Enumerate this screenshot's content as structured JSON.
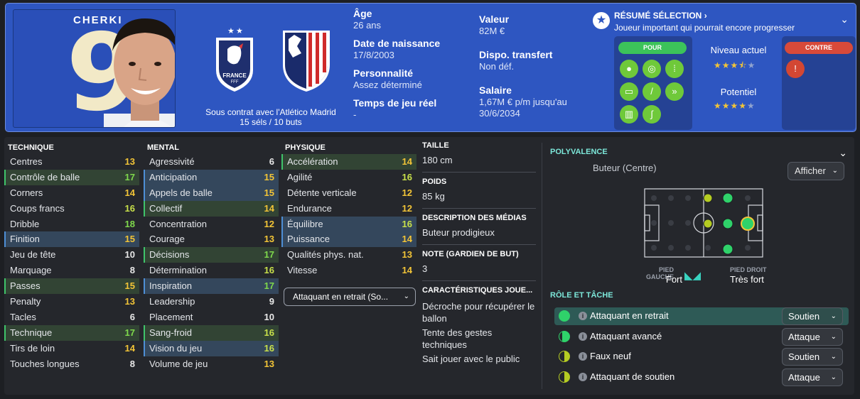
{
  "player": {
    "shirt_name": "CHERKI",
    "shirt_number": "9",
    "contract_line1": "Sous contrat avec l'Atlético Madrid",
    "contract_line2": "15 séls / 10 buts"
  },
  "crests": {
    "nation": "FRANCE",
    "nation_sub": "FFF"
  },
  "info_left": [
    {
      "label": "Âge",
      "value": "26 ans"
    },
    {
      "label": "Date de naissance",
      "value": "17/8/2003"
    },
    {
      "label": "Personnalité",
      "value": "Assez déterminé"
    },
    {
      "label": "Temps de jeu réel",
      "value": "-"
    }
  ],
  "info_right": [
    {
      "label": "Valeur",
      "value": "82M €"
    },
    {
      "label": "Dispo. transfert",
      "value": "Non déf."
    },
    {
      "label": "Salaire",
      "value": "1,67M € p/m jusqu'au 30/6/2034"
    }
  ],
  "selection": {
    "title": "RÉSUMÉ SÉLECTION",
    "subtitle": "Joueur important qui pourrait encore progresser",
    "pour": "POUR",
    "contre": "CONTRE",
    "niveau_label": "Niveau actuel",
    "niveau_stars": 3.5,
    "potentiel_label": "Potentiel",
    "potentiel_stars": 4
  },
  "technique": {
    "title": "TECHNIQUE",
    "rows": [
      {
        "name": "Centres",
        "value": "13"
      },
      {
        "name": "Contrôle de balle",
        "value": "17"
      },
      {
        "name": "Corners",
        "value": "14"
      },
      {
        "name": "Coups francs",
        "value": "16"
      },
      {
        "name": "Dribble",
        "value": "18"
      },
      {
        "name": "Finition",
        "value": "15"
      },
      {
        "name": "Jeu de tête",
        "value": "10"
      },
      {
        "name": "Marquage",
        "value": "8"
      },
      {
        "name": "Passes",
        "value": "15"
      },
      {
        "name": "Penalty",
        "value": "13"
      },
      {
        "name": "Tacles",
        "value": "6"
      },
      {
        "name": "Technique",
        "value": "17"
      },
      {
        "name": "Tirs de loin",
        "value": "14"
      },
      {
        "name": "Touches longues",
        "value": "8"
      }
    ]
  },
  "mental": {
    "title": "MENTAL",
    "rows": [
      {
        "name": "Agressivité",
        "value": "6"
      },
      {
        "name": "Anticipation",
        "value": "15"
      },
      {
        "name": "Appels de balle",
        "value": "15"
      },
      {
        "name": "Collectif",
        "value": "14"
      },
      {
        "name": "Concentration",
        "value": "12"
      },
      {
        "name": "Courage",
        "value": "13"
      },
      {
        "name": "Décisions",
        "value": "17"
      },
      {
        "name": "Détermination",
        "value": "16"
      },
      {
        "name": "Inspiration",
        "value": "17"
      },
      {
        "name": "Leadership",
        "value": "9"
      },
      {
        "name": "Placement",
        "value": "10"
      },
      {
        "name": "Sang-froid",
        "value": "16"
      },
      {
        "name": "Vision du jeu",
        "value": "16"
      },
      {
        "name": "Volume de jeu",
        "value": "13"
      }
    ]
  },
  "physique": {
    "title": "PHYSIQUE",
    "rows": [
      {
        "name": "Accélération",
        "value": "14"
      },
      {
        "name": "Agilité",
        "value": "16"
      },
      {
        "name": "Détente verticale",
        "value": "12"
      },
      {
        "name": "Endurance",
        "value": "12"
      },
      {
        "name": "Équilibre",
        "value": "16"
      },
      {
        "name": "Puissance",
        "value": "14"
      },
      {
        "name": "Qualités phys. nat.",
        "value": "13"
      },
      {
        "name": "Vitesse",
        "value": "14"
      }
    ],
    "role_select": "Attaquant en retrait (So..."
  },
  "details": {
    "taille_label": "TAILLE",
    "taille": "180 cm",
    "poids_label": "POIDS",
    "poids": "85 kg",
    "media_label": "DESCRIPTION DES MÉDIAS",
    "media": "Buteur prodigieux",
    "gk_label": "NOTE (GARDIEN DE BUT)",
    "gk": "3",
    "traits_label": "CARACTÉRISTIQUES JOUE...",
    "traits": [
      "Décroche pour récupérer le ballon",
      "Tente des gestes techniques",
      "Sait jouer avec le public"
    ]
  },
  "polyvalence": {
    "title": "POLYVALENCE",
    "position": "Buteur (Centre)",
    "show_button": "Afficher",
    "left_foot_label": "PIED GAUCHE",
    "left_foot": "Fort",
    "right_foot_label": "PIED DROIT",
    "right_foot": "Très fort"
  },
  "roles": {
    "title": "RÔLE ET TÂCHE",
    "rows": [
      {
        "name": "Attaquant en retrait",
        "duty": "Soutien"
      },
      {
        "name": "Attaquant avancé",
        "duty": "Attaque"
      },
      {
        "name": "Faux neuf",
        "duty": "Soutien"
      },
      {
        "name": "Attaquant de soutien",
        "duty": "Attaque"
      }
    ]
  }
}
